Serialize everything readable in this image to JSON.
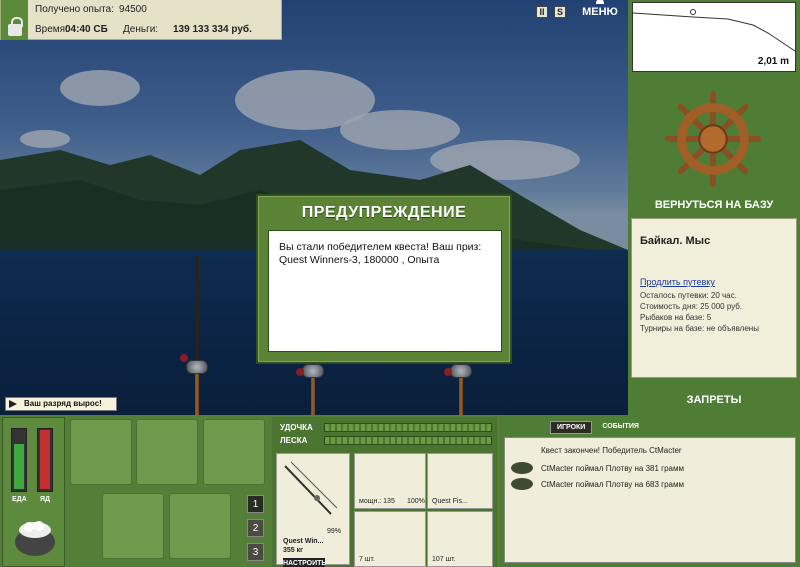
{
  "topbar": {
    "experience_label": "Получено опыта:",
    "experience_value": "94500",
    "time_label": "Время:",
    "time_value": "04:40 СБ",
    "money_label": "Деньги:",
    "money_value": "139 133 334 руб.",
    "pause_icon": "pause-icon",
    "sound_label": "S",
    "menu_label": "МЕНЮ"
  },
  "depth": {
    "value": "2,01 m"
  },
  "right_panel": {
    "return_label": "ВЕРНУТЬСЯ НА БАЗУ",
    "location_name": "Байкал. Мыс",
    "extend_trip": "Продлить путевку",
    "lines": [
      "Осталось путевки: 20 час.",
      "Стоимость дня: 25 000 руб.",
      "Рыбаков на базе: 5",
      "Турниры на базе: не объявлены"
    ],
    "bans_label": "ЗАПРЕТЫ"
  },
  "notice": {
    "level_up": "Ваш разряд вырос!"
  },
  "modal": {
    "title": "ПРЕДУПРЕЖДЕНИЕ",
    "message": "Вы стали победителем квеста! Ваш приз: Quest Winners-3, 180000 , Опыта"
  },
  "meters": {
    "food_label": "ЕДА",
    "poison_label": "ЯД",
    "food_level": 0.72,
    "poison_level": 0.95
  },
  "inventory": {
    "pages": [
      "1",
      "2",
      "3"
    ],
    "active_page": "1"
  },
  "tackle": {
    "rod_bar_label": "УДОЧКА",
    "line_bar_label": "ЛЕСКА",
    "rod_name": "Quest Win...",
    "rod_weight": "355 кг",
    "rod_condition": "99%",
    "setup_label": "НАСТРОИТЬ",
    "reel_power": "мощн.: 135",
    "reel_condition": "100%",
    "line_name": "Quest Fis...",
    "hooks_count": "7 шт.",
    "bait_count": "107 шт."
  },
  "chat": {
    "tabs": [
      "ИГРОКИ",
      "СОБЫТИЯ"
    ],
    "active_tab": "ИГРОКИ",
    "messages": [
      "Квест закончен! Победитель CtMacter",
      "CtMacter поймал Плотву на 381 грамм",
      "CtMacter поймал Плотву на 683 грамм"
    ]
  },
  "colors": {
    "panel_green": "#4f7d35",
    "paper": "#f0eedb",
    "link": "#1a3aa0"
  }
}
